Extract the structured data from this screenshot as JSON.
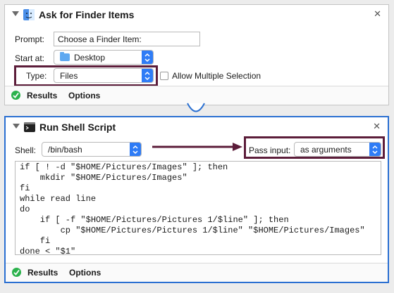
{
  "actions": [
    {
      "title": "Ask for Finder Items",
      "prompt_label": "Prompt:",
      "prompt_value": "Choose a Finder Item:",
      "start_at_label": "Start at:",
      "start_at_value": "Desktop",
      "type_label": "Type:",
      "type_value": "Files",
      "allow_multiple_label": "Allow Multiple Selection",
      "results_label": "Results",
      "options_label": "Options"
    },
    {
      "title": "Run Shell Script",
      "shell_label": "Shell:",
      "shell_value": "/bin/bash",
      "pass_input_label": "Pass input:",
      "pass_input_value": "as arguments",
      "script_lines": [
        "if [ ! -d \"$HOME/Pictures/Images\" ]; then",
        "    mkdir \"$HOME/Pictures/Images\"",
        "fi",
        "while read line",
        "do",
        "    if [ -f \"$HOME/Pictures/Pictures 1/$line\" ]; then",
        "        cp \"$HOME/Pictures/Pictures 1/$line\" \"$HOME/Pictures/Images\"",
        "    fi",
        "done < \"$1\""
      ],
      "results_label": "Results",
      "options_label": "Options"
    }
  ],
  "colors": {
    "highlight": "#5c1d3a",
    "selected_border": "#2a6fd1",
    "popup_accent": "#2f7cf6",
    "success": "#2bb24c"
  }
}
